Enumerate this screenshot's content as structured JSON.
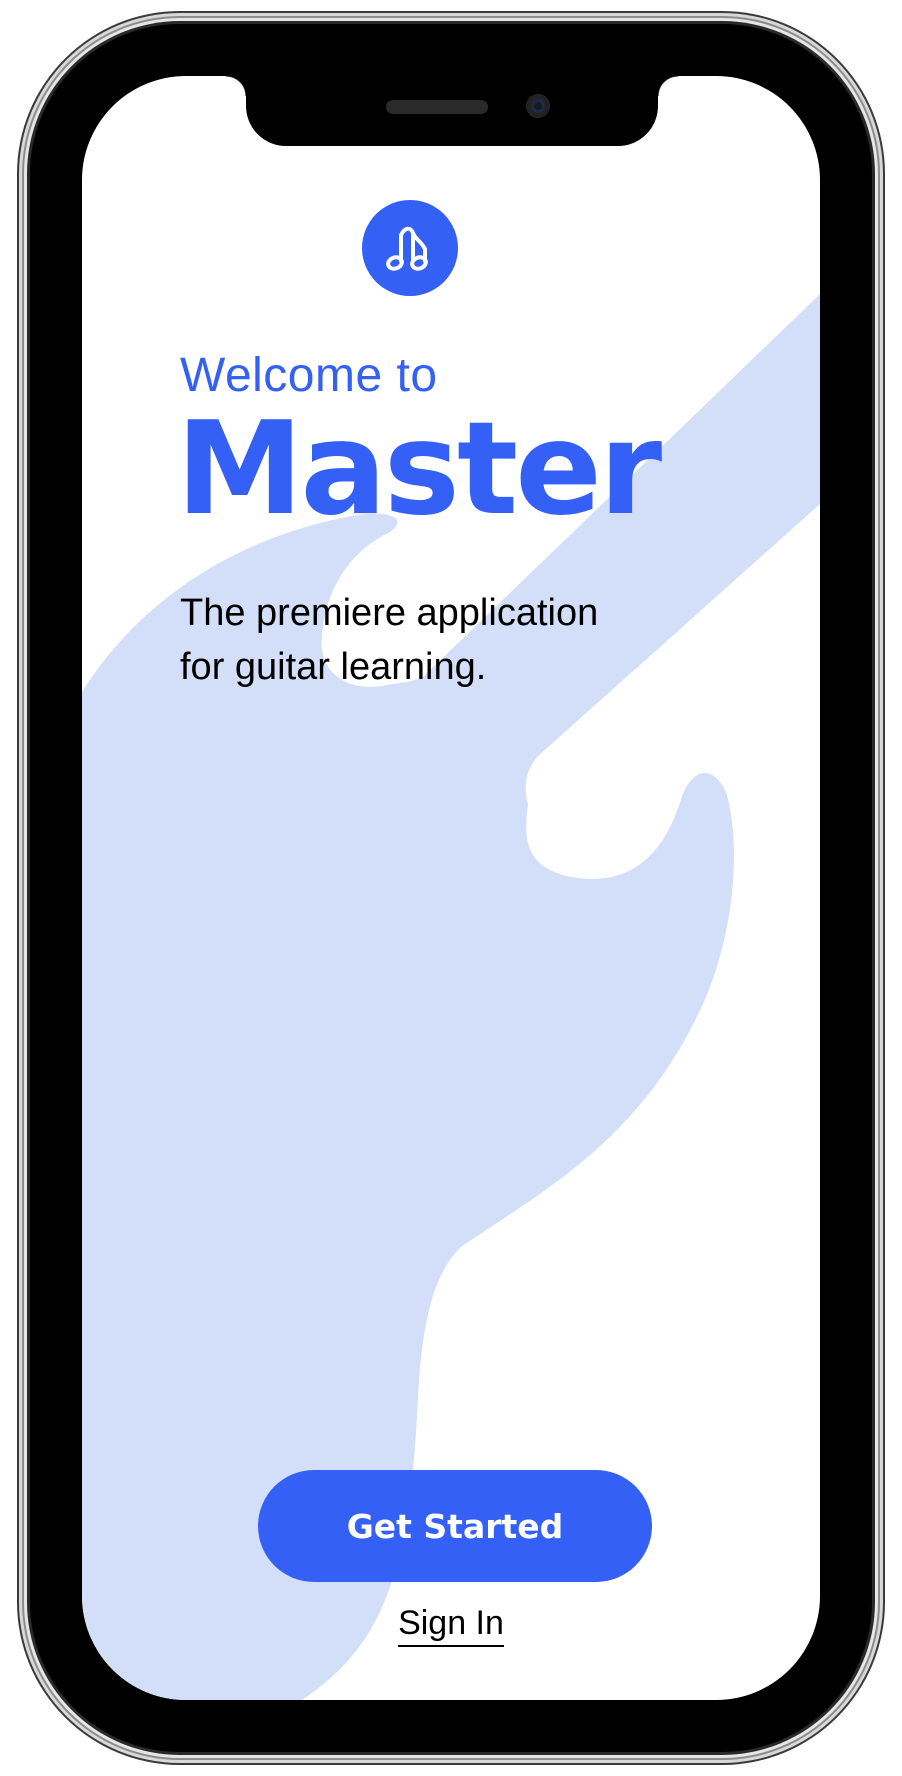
{
  "app": {
    "logo_icon": "music-note-icon",
    "welcome_text": "Welcome to",
    "title": "Master",
    "tagline_line1": "The premiere application",
    "tagline_line2": "for guitar learning.",
    "primary_button_label": "Get Started",
    "secondary_link_label": "Sign In"
  },
  "colors": {
    "accent": "#3560f5",
    "guitar_background": "#d3dff8",
    "text": "#000000",
    "screen_background": "#ffffff"
  },
  "background_illustration": "guitar-silhouette"
}
